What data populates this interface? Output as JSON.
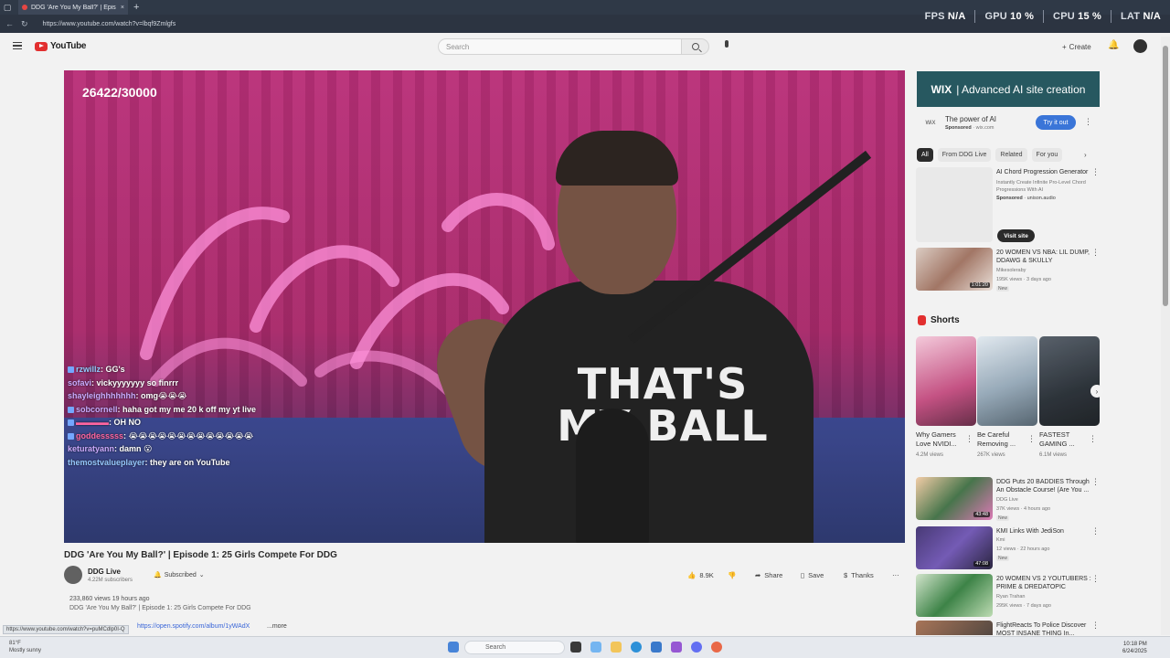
{
  "browser": {
    "tab_title": "DDG 'Are You My Ball?' | Epis",
    "url": "https://www.youtube.com/watch?v=lbqf9Zmlgfs",
    "hud": {
      "fps_label": "FPS",
      "fps": "N/A",
      "gpu_label": "GPU",
      "gpu": "10 %",
      "cpu_label": "CPU",
      "cpu": "15 %",
      "lat_label": "LAT",
      "lat": "N/A"
    }
  },
  "header": {
    "logo_text": "YouTube",
    "search_placeholder": "Search",
    "create_label": "Create"
  },
  "video": {
    "counter": "26422/30000",
    "shirt_text": "THAT'S MY BALL",
    "chat": [
      {
        "user": "rzwillz",
        "msg": "GG's",
        "style": "blue"
      },
      {
        "user": "sofavi",
        "msg": "vickyyyyyyy so finrrr",
        "style": "default"
      },
      {
        "user": "shayleighhhhhhh",
        "msg": "omg😭😭😭",
        "style": "default"
      },
      {
        "user": "sobcornell",
        "msg": "haha got my me 20 k off my yt live",
        "style": "default"
      },
      {
        "user": "",
        "msg": "OH NO",
        "style": "pink"
      },
      {
        "user": "goddesssss",
        "msg": "😭😭😭😭😭😭😭😭😭😭😭😭😭",
        "style": "pink"
      },
      {
        "user": "keturatyann",
        "msg": "damn 😮",
        "style": "default"
      },
      {
        "user": "themostvalueplayer",
        "msg": "they are on YouTube",
        "style": "blue"
      }
    ],
    "title": "DDG 'Are You My Ball?' | Episode 1: 25 Girls Compete For DDG",
    "channel": "DDG Live",
    "subscribers": "4.22M subscribers",
    "subscribed_label": "Subscribed",
    "likes": "8.9K",
    "share_label": "Share",
    "save_label": "Save",
    "thanks_label": "Thanks",
    "views_line": "233,860 views  19 hours ago",
    "desc_line": "DDG 'Are You My Ball?' | Episode 1: 25 Girls Compete For DDG",
    "desc_link": "https://open.spotify.com/album/1yWAdX",
    "more_label": "...more",
    "status_url": "https://www.youtube.com/watch?v=puMCdlp0I-Q"
  },
  "sidebar": {
    "ad_banner": {
      "brand": "WIX",
      "text": "| Advanced AI site creation"
    },
    "ad_row": {
      "logo": "WiX",
      "title": "The power of AI",
      "sponsored": "Sponsored",
      "domain": "· wix.com",
      "cta": "Try it out"
    },
    "chips": [
      "All",
      "From DDG Live",
      "Related",
      "For you"
    ],
    "sponsored_item": {
      "title": "AI Chord Progression Generator",
      "sub": "Instantly Create Infinite Pro-Level Chord Progressions With AI",
      "sponsored": "Sponsored",
      "domain": "· unison.audio",
      "cta": "Visit site"
    },
    "recs_top": [
      {
        "title": "20 WOMEN VS NBA: LIL DUMP, DDAWG & SKULLY",
        "channel": "Mikesoleraby",
        "meta": "195K views · 3 days ago",
        "badge": "New",
        "duration": "1:01:20"
      }
    ],
    "shorts_label": "Shorts",
    "shorts": [
      {
        "title": "Why Gamers Love NVIDI...",
        "views": "4.2M views"
      },
      {
        "title": "Be Careful Removing ...",
        "views": "267K views"
      },
      {
        "title": "FASTEST GAMING ...",
        "views": "6.1M views"
      }
    ],
    "recs_bottom": [
      {
        "title": "DDG Puts 20 BADDIES Through An Obstacle Course! (Are You ...",
        "channel": "DDG Live",
        "meta": "37K views · 4 hours ago",
        "badge": "New",
        "duration": "43:48"
      },
      {
        "title": "KMI Links With JediSon",
        "channel": "Kmi",
        "meta": "12 views · 22 hours ago",
        "badge": "New",
        "duration": "47:08"
      },
      {
        "title": "20 WOMEN VS 2 YOUTUBERS : PRIME & DREDATOPIC",
        "channel": "Ryan Trahan",
        "meta": "295K views · 7 days ago",
        "badge": "",
        "duration": ""
      },
      {
        "title": "FlightReacts To Police Discover MOST INSANE THING In...",
        "channel": "",
        "meta": "",
        "badge": "",
        "duration": ""
      }
    ]
  },
  "taskbar": {
    "weather_temp": "81°F",
    "weather_desc": "Mostly sunny",
    "search_placeholder": "Search",
    "time": "10:18 PM",
    "date": "6/24/2025"
  }
}
